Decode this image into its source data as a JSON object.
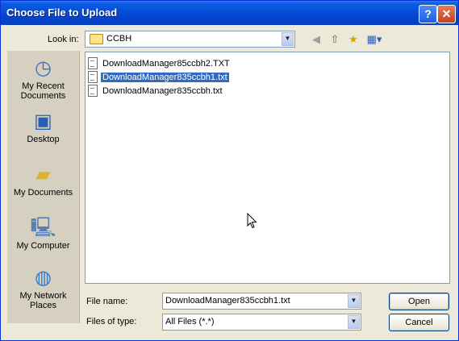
{
  "window": {
    "title": "Choose File to Upload"
  },
  "titlebar": {
    "help_label": "?",
    "close_label": "✕"
  },
  "look_in": {
    "label": "Look in:",
    "value": "CCBH"
  },
  "places": [
    {
      "name": "recent",
      "label": "My Recent Documents",
      "icon": "clock-icon"
    },
    {
      "name": "desktop",
      "label": "Desktop",
      "icon": "desktop-icon"
    },
    {
      "name": "documents",
      "label": "My Documents",
      "icon": "folder-icon"
    },
    {
      "name": "computer",
      "label": "My Computer",
      "icon": "computer-icon"
    },
    {
      "name": "network",
      "label": "My Network Places",
      "icon": "globe-icon"
    }
  ],
  "files": [
    {
      "name": "DownloadManager85ccbh2.TXT",
      "selected": false
    },
    {
      "name": "DownloadManager835ccbh1.txt",
      "selected": true
    },
    {
      "name": "DownloadManager835ccbh.txt",
      "selected": false
    }
  ],
  "file_name": {
    "label": "File name:",
    "value": "DownloadManager835ccbh1.txt"
  },
  "file_type": {
    "label": "Files of type:",
    "value": "All Files (*.*)"
  },
  "buttons": {
    "open": "Open",
    "cancel": "Cancel"
  }
}
